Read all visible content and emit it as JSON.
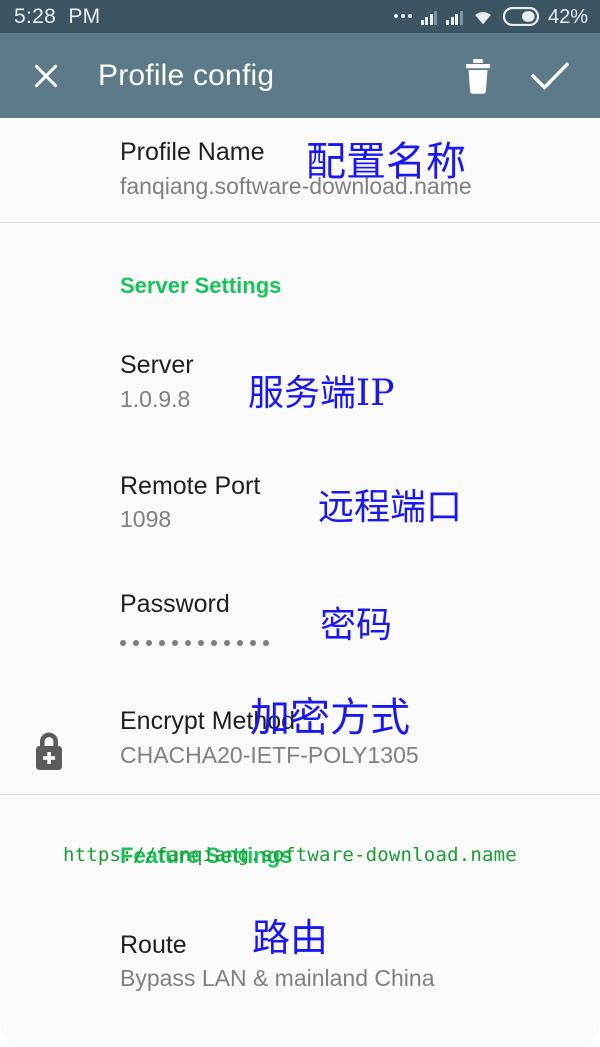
{
  "status_bar": {
    "time": "5:28  PM",
    "dots_icon": "more-dots-icon",
    "signal1_icon": "signal-bars-icon",
    "signal2_icon": "signal-bars-icon",
    "wifi_icon": "wifi-icon",
    "battery_icon": "battery-icon",
    "battery_percent": "42%",
    "background_color": "#3d5562"
  },
  "app_bar": {
    "close_icon": "close-icon",
    "title": "Profile config",
    "delete_icon": "trash-icon",
    "confirm_icon": "check-icon",
    "background_color": "#5c7a88"
  },
  "watermark": {
    "url": "https://fanqiang.software-download.name",
    "color": "#1a9e34"
  },
  "annotation_color": "#1a18f0",
  "section_color": "#16c45a",
  "profile": {
    "label": "Profile Name",
    "value": "fanqiang.software-download.name",
    "annotation": "配置名称"
  },
  "server_settings": {
    "title": "Server Settings",
    "rows": [
      {
        "name": "server",
        "label": "Server",
        "value": "1.0.9.8",
        "annotation": "服务端IP"
      },
      {
        "name": "remote-port",
        "label": "Remote Port",
        "value": "1098",
        "annotation": "远程端口"
      },
      {
        "name": "password",
        "label": "Password",
        "value": "••••••••••••",
        "masked_dot_count": 12,
        "annotation": "密码"
      },
      {
        "name": "encrypt-method",
        "label": "Encrypt Method",
        "value": "CHACHA20-IETF-POLY1305",
        "annotation": "加密方式",
        "icon": "lock-plus-icon"
      }
    ]
  },
  "feature_settings": {
    "title": "Feature Settings",
    "rows": [
      {
        "name": "route",
        "label": "Route",
        "value": "Bypass LAN & mainland China",
        "annotation": "路由"
      }
    ]
  }
}
